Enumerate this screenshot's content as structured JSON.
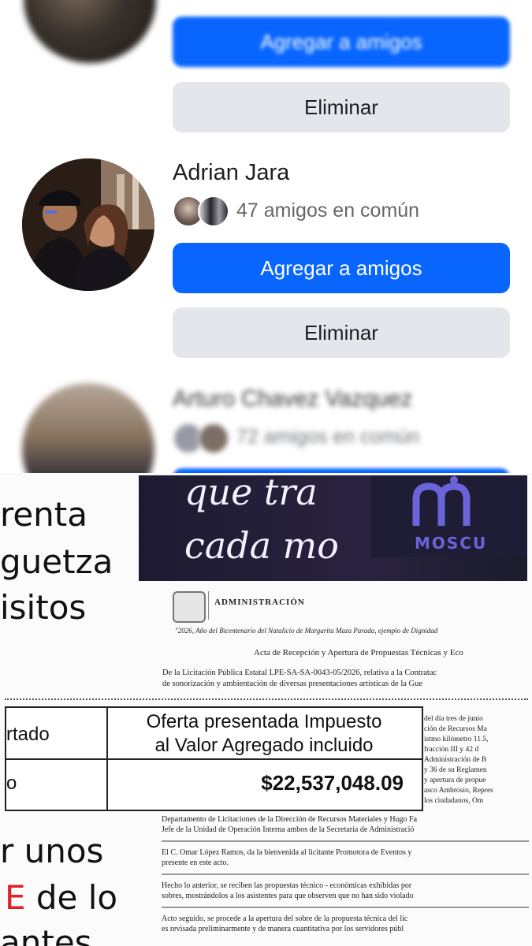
{
  "suggestions": [
    {
      "add_label": "Agregar a amigos",
      "remove_label": "Eliminar"
    },
    {
      "name": "Adrian Jara",
      "mutual": "47 amigos en común",
      "add_label": "Agregar a amigos",
      "remove_label": "Eliminar"
    },
    {
      "name": "Arturo Chavez Vazquez",
      "mutual": "72 amigos en común"
    }
  ],
  "colors": {
    "primary_blue": "#0866ff",
    "secondary_gray": "#e4e6eb",
    "text_dark": "#1c1e21",
    "text_muted": "#65676b"
  },
  "icons": [
    "profile-avatar",
    "mutual-friend-avatar"
  ],
  "document": {
    "left_words": [
      "renta",
      "guetza",
      "isitos",
      "r unos",
      "E",
      " de lo",
      "antes"
    ],
    "banner_line1": "que tra",
    "banner_line2": "cada mo",
    "logo_text": "MOSCU",
    "header_label": "ADMINISTRACIÓN",
    "year_motto": "\"2026, Año del Bicentenario del Natalicio de Margarita Maza Parada, ejemplo de Dignidad",
    "acta_title": "Acta de Recepción y Apertura de Propuestas Técnicas y Eco",
    "licitacion": "De la Licitación Pública Estatal LPE-SA-SA-0043-05/2026, relativa a la Contratac",
    "licitacion_2": "de sonorización y ambientación de diversas presentaciones artísticas de la Gue",
    "table_header_left": "rtado",
    "table_header_right_1": "Oferta presentada Impuesto",
    "table_header_right_2": "al Valor Agregado incluido",
    "table_row_left": "o",
    "table_row_amount": "$22,537,048.09",
    "paragraph_1": "Departamento de Licitaciones de la Dirección de Recursos Materiales y Hugo Fa",
    "paragraph_2": "Jefe de la Unidad de Operación Interna ambos de la Secretaría de Administració",
    "paragraph_3": "El C. Omar López Ramos, da la bienvenida al licitante Promotora de Eventos y",
    "paragraph_4": "presente en este acto.",
    "paragraph_5": "Hecho lo anterior, se reciben las propuestas técnico - económicas exhibidas por",
    "paragraph_6": "sobres, mostrándolos a los asistentes para que observen que no han sido violado",
    "paragraph_7": "Acto seguido, se procede a la apertura del sobre de la propuesta técnica del lic",
    "paragraph_8": "es revisada preliminarmente y de manera cuantitativa por los servidores públ",
    "side_col": [
      "del día tres de junio",
      "ción de Recursos Ma",
      "istmo kilómetro 11.5,",
      "fracción III y 42 d",
      "Administración de B",
      "y 36 de su Reglamen",
      "y apertura de propue",
      "asco Ambrosio, Repres",
      "los ciudadanos, Om"
    ]
  }
}
